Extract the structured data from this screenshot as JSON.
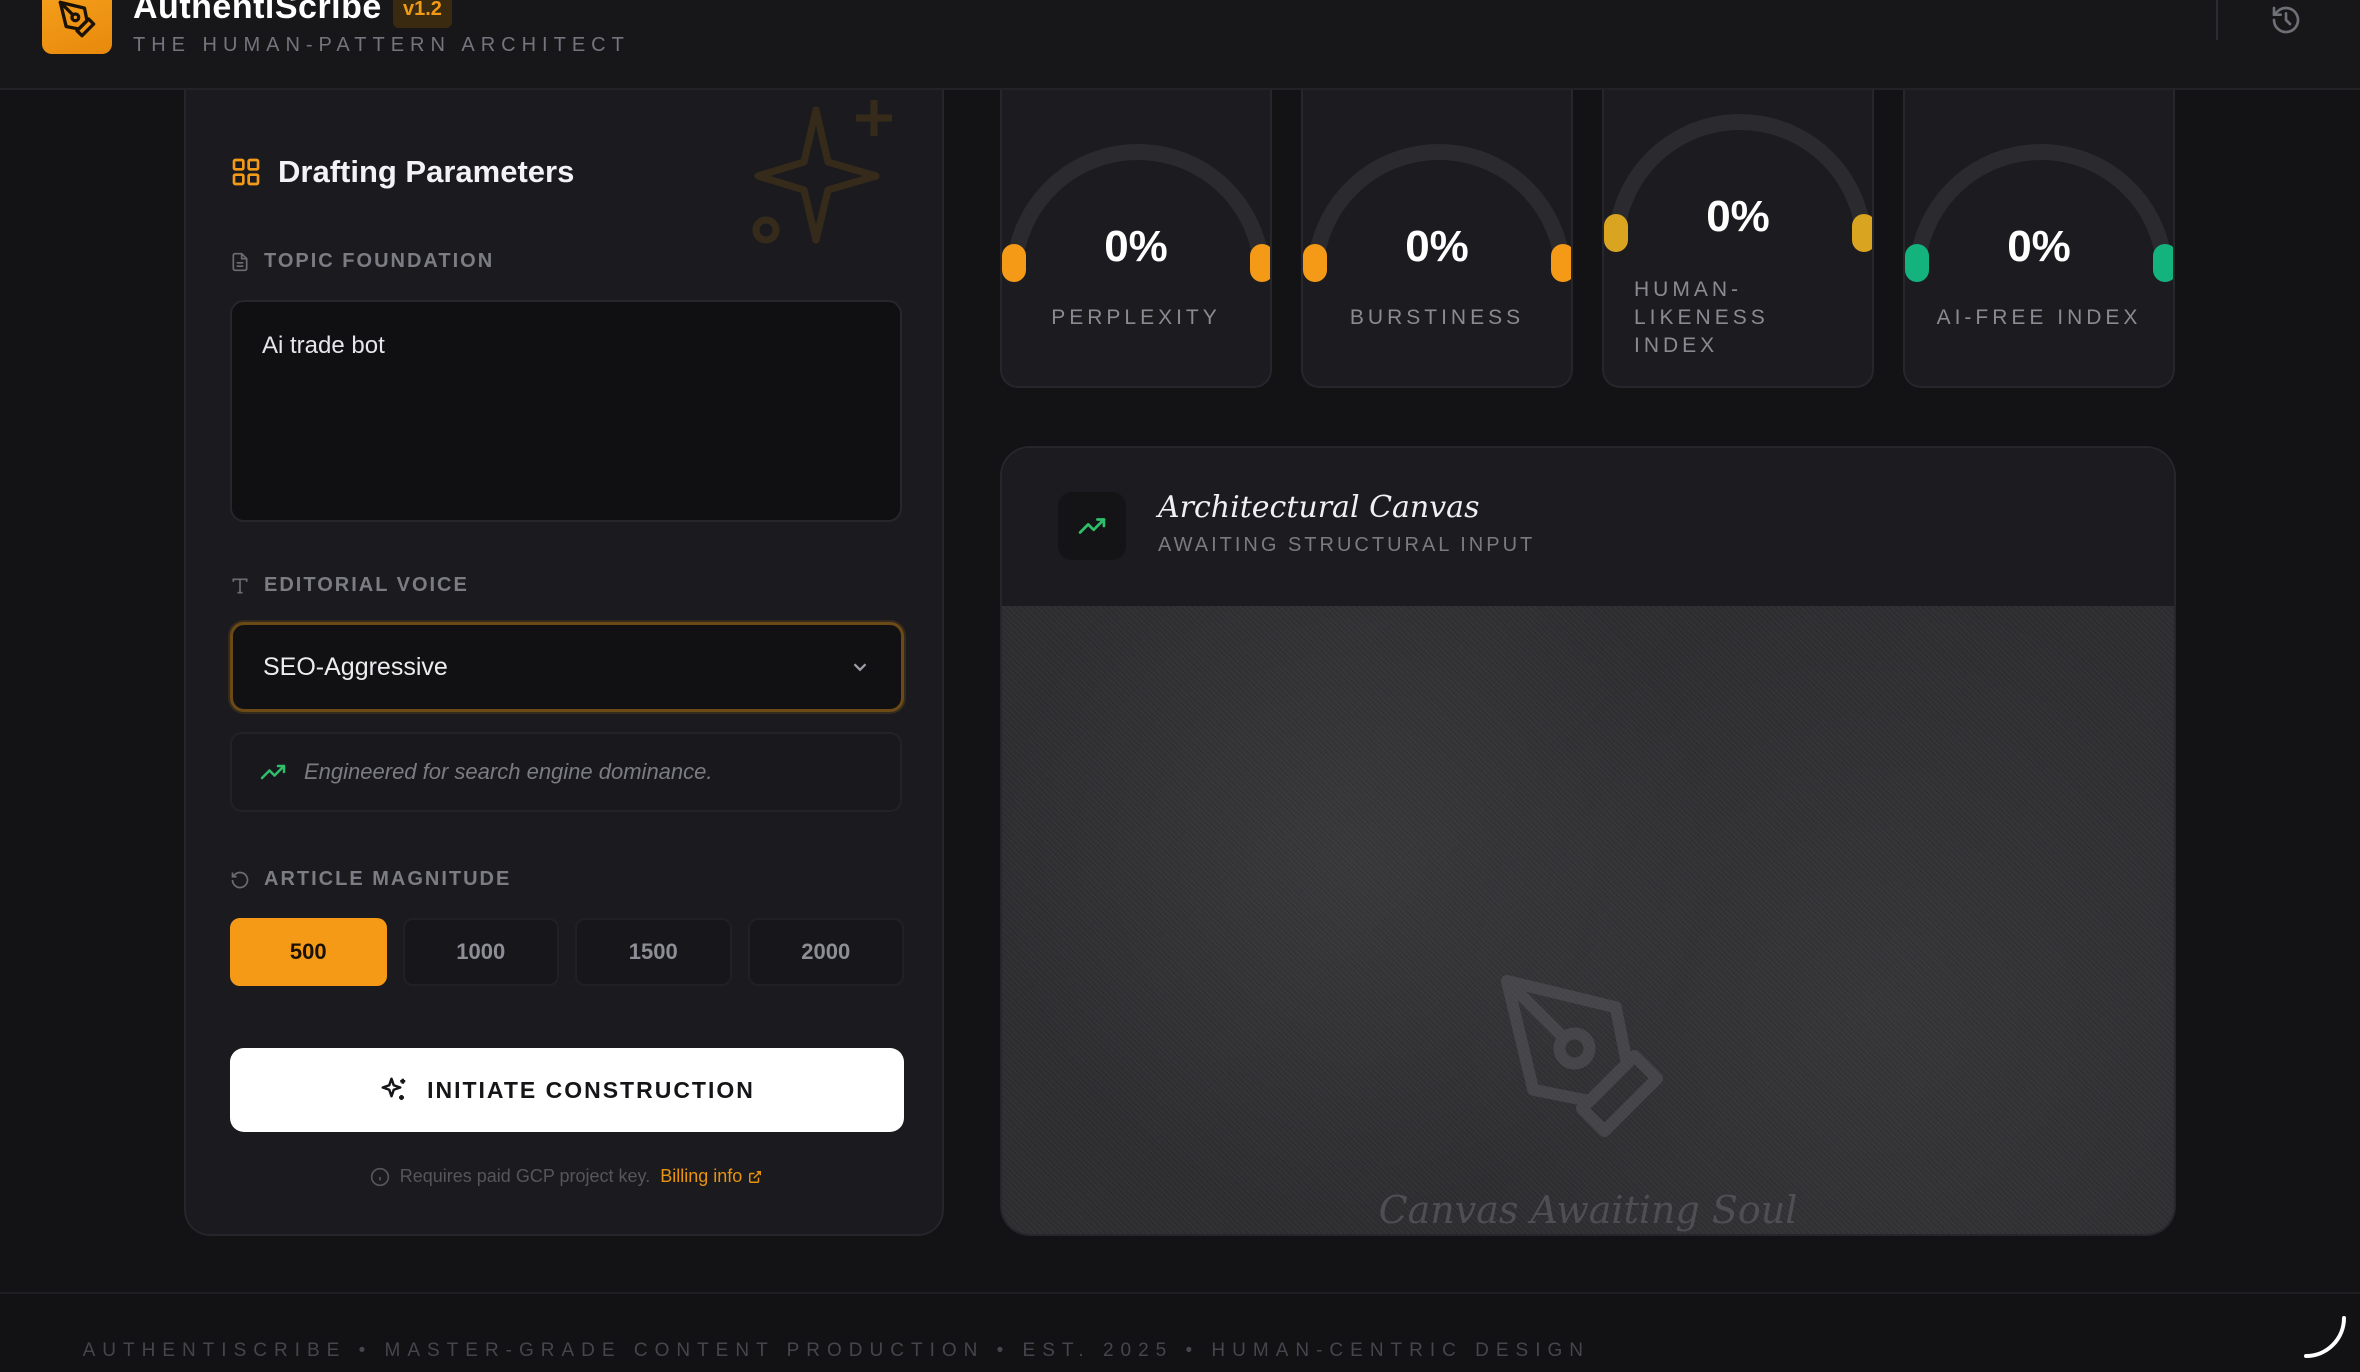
{
  "header": {
    "app_title": "AuthentiScribe",
    "version": "v1.2",
    "tagline": "THE HUMAN-PATTERN ARCHITECT"
  },
  "params": {
    "title": "Drafting Parameters",
    "topic_label": "TOPIC FOUNDATION",
    "topic_value": "Ai trade bot",
    "voice_label": "EDITORIAL VOICE",
    "voice_selected": "SEO-Aggressive",
    "voice_description": "Engineered for search engine dominance.",
    "magnitude_label": "ARTICLE MAGNITUDE",
    "magnitudes": [
      "500",
      "1000",
      "1500",
      "2000"
    ],
    "magnitude_selected": "500",
    "initiate_label": "INITIATE CONSTRUCTION",
    "billing_note": "Requires paid GCP project key.",
    "billing_link": "Billing info"
  },
  "metrics": [
    {
      "label": "PERPLEXITY",
      "value": "0%",
      "level": 0,
      "color": "#f49a16"
    },
    {
      "label": "BURSTINESS",
      "value": "0%",
      "level": 0,
      "color": "#f49a16"
    },
    {
      "label": "HUMAN-LIKENESS INDEX",
      "value": "0%",
      "level": 0,
      "color": "#d9a420"
    },
    {
      "label": "AI-FREE INDEX",
      "value": "0%",
      "level": 0,
      "color": "#14b37d"
    }
  ],
  "canvas": {
    "title": "Architectural Canvas",
    "subtitle": "AWAITING STRUCTURAL INPUT",
    "empty_text": "Canvas Awaiting Soul"
  },
  "footer": {
    "text": "AUTHENTISCRIBE • MASTER-GRADE CONTENT PRODUCTION • EST. 2025 • HUMAN-CENTRIC DESIGN"
  },
  "colors": {
    "accent": "#f49a16",
    "trend_green": "#2fbf6a",
    "background": "#131316"
  },
  "icons": {
    "logo": "pen-nib-icon",
    "history": "history-icon",
    "params": "grid-icon",
    "topic": "document-icon",
    "voice": "type-icon",
    "magnitude": "rotate-icon",
    "initiate": "sparkles-icon",
    "canvas": "trending-up-icon"
  }
}
